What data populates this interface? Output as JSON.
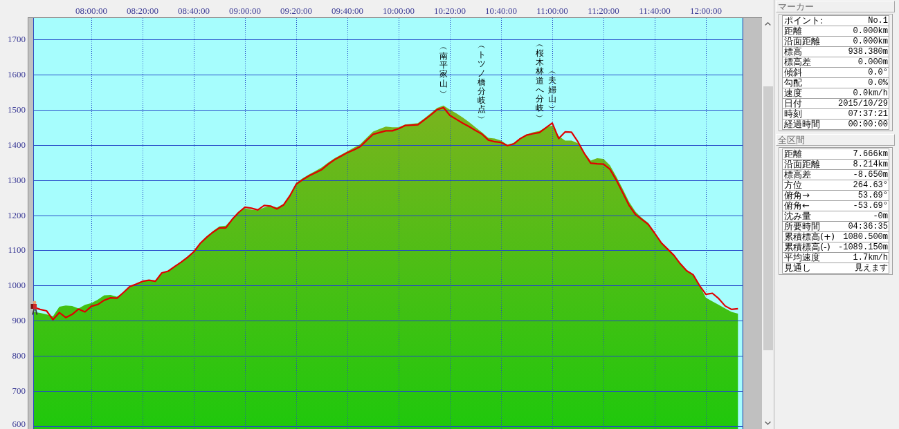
{
  "chart": {
    "chart_data": {
      "type": "area",
      "ylim": [
        592,
        1761
      ],
      "grid": true,
      "categories": [
        null,
        null,
        null,
        null,
        null,
        null,
        null,
        null,
        null,
        "08:00:00",
        null,
        null,
        null,
        null,
        null,
        null,
        null,
        "08:20:00",
        null,
        null,
        null,
        null,
        null,
        null,
        null,
        "08:40:00",
        null,
        null,
        null,
        null,
        null,
        null,
        null,
        "09:00:00",
        null,
        null,
        null,
        null,
        null,
        null,
        null,
        "09:20:00",
        null,
        null,
        null,
        null,
        null,
        null,
        null,
        "09:40:00",
        null,
        null,
        null,
        null,
        null,
        null,
        null,
        "10:00:00",
        null,
        null,
        null,
        null,
        null,
        null,
        null,
        "10:20:00",
        null,
        null,
        null,
        null,
        null,
        null,
        null,
        "10:40:00",
        null,
        null,
        null,
        null,
        null,
        null,
        null,
        "11:00:00",
        null,
        null,
        null,
        null,
        null,
        null,
        null,
        "11:20:00",
        null,
        null,
        null,
        null,
        null,
        null,
        null,
        "11:40:00",
        null,
        null,
        null,
        null,
        null,
        null,
        null,
        "12:00:00",
        null,
        null,
        null,
        null,
        null
      ],
      "yticks": [
        1700,
        1600,
        1500,
        1400,
        1300,
        1200,
        1100,
        1000,
        900,
        800,
        700,
        600
      ],
      "series": [
        {
          "type": "area",
          "color": "#7ab41e",
          "values": [
            925,
            922,
            918,
            912,
            940,
            943,
            942,
            935,
            945,
            950,
            960,
            972,
            973,
            968,
            978,
            995,
            1005,
            1012,
            1015,
            1015,
            1034,
            1042,
            1055,
            1068,
            1082,
            1098,
            1122,
            1140,
            1155,
            1168,
            1170,
            1190,
            1210,
            1220,
            1216,
            1214,
            1222,
            1226,
            1222,
            1232,
            1258,
            1292,
            1305,
            1316,
            1326,
            1336,
            1350,
            1362,
            1372,
            1382,
            1392,
            1402,
            1420,
            1438,
            1445,
            1452,
            1450,
            1450,
            1458,
            1460,
            1462,
            1475,
            1490,
            1505,
            1512,
            1500,
            1490,
            1478,
            1465,
            1450,
            1436,
            1420,
            1418,
            1412,
            1400,
            1406,
            1420,
            1430,
            1436,
            1440,
            1450,
            1455,
            1425,
            1412,
            1412,
            1405,
            1378,
            1355,
            1362,
            1360,
            1342,
            1310,
            1275,
            1238,
            1210,
            1192,
            1178,
            1150,
            1124,
            1106,
            1088,
            1063,
            1043,
            1030,
            1000,
            965,
            955,
            945,
            935,
            925,
            920
          ]
        },
        {
          "type": "line",
          "color": "#e00000",
          "values": [
            938,
            932,
            928,
            903,
            923,
            909,
            918,
            933,
            925,
            941,
            946,
            958,
            965,
            964,
            980,
            997,
            1004,
            1012,
            1015,
            1012,
            1036,
            1041,
            1054,
            1066,
            1080,
            1096,
            1120,
            1137,
            1152,
            1164,
            1164,
            1188,
            1208,
            1223,
            1220,
            1215,
            1228,
            1226,
            1218,
            1229,
            1255,
            1288,
            1301,
            1312,
            1321,
            1330,
            1345,
            1358,
            1368,
            1378,
            1386,
            1395,
            1413,
            1430,
            1435,
            1440,
            1440,
            1446,
            1455,
            1456,
            1457,
            1471,
            1485,
            1500,
            1506,
            1484,
            1473,
            1462,
            1452,
            1441,
            1431,
            1414,
            1409,
            1407,
            1398,
            1403,
            1418,
            1428,
            1432,
            1435,
            1449,
            1462,
            1418,
            1437,
            1436,
            1409,
            1376,
            1348,
            1346,
            1345,
            1331,
            1300,
            1264,
            1228,
            1202,
            1188,
            1174,
            1149,
            1122,
            1104,
            1086,
            1062,
            1042,
            1031,
            1000,
            975,
            978,
            963,
            942,
            932,
            934
          ]
        }
      ],
      "annotations": [
        "︵南平家山︶",
        "︵トツノ橋分岐点︶",
        "︵桜木林道へ分岐︶",
        "︵夫婦山︶"
      ]
    }
  },
  "panels": [
    {
      "title": "マーカー",
      "rows": [
        {
          "label": "ポイント:",
          "value": "No.1"
        },
        {
          "label": "距離",
          "value": "0.000km"
        },
        {
          "label": "沿面距離",
          "value": "0.000km"
        },
        {
          "label": "標高",
          "value": "938.380m"
        },
        {
          "label": "標高差",
          "value": "0.000m"
        },
        {
          "label": "傾斜",
          "value": "0.0°"
        },
        {
          "label": "勾配",
          "value": "0.0%"
        },
        {
          "label": "速度",
          "value": "0.0km/h"
        },
        {
          "label": "日付",
          "value": "2015/10/29"
        },
        {
          "label": "時刻",
          "value": "07:37:21"
        },
        {
          "label": "経過時間",
          "value": "00:00:00"
        }
      ]
    },
    {
      "title": "全区間",
      "rows": [
        {
          "label": "距離",
          "value": "7.666km"
        },
        {
          "label": "沿面距離",
          "value": "8.214km"
        },
        {
          "label": "標高差",
          "value": "-8.650m"
        },
        {
          "label": "方位",
          "value": "264.63°"
        },
        {
          "label": "俯角→",
          "value": "53.69°"
        },
        {
          "label": "俯角←",
          "value": "-53.69°"
        },
        {
          "label": "沈み量",
          "value": "-0m"
        },
        {
          "label": "所要時間",
          "value": "04:36:35"
        },
        {
          "label": "累積標高(+)",
          "value": "1080.500m"
        },
        {
          "label": "累積標高(-)",
          "value": "-1089.150m"
        },
        {
          "label": "平均速度",
          "value": "1.7km/h"
        },
        {
          "label": "見通し",
          "value": "見えます"
        }
      ]
    }
  ]
}
